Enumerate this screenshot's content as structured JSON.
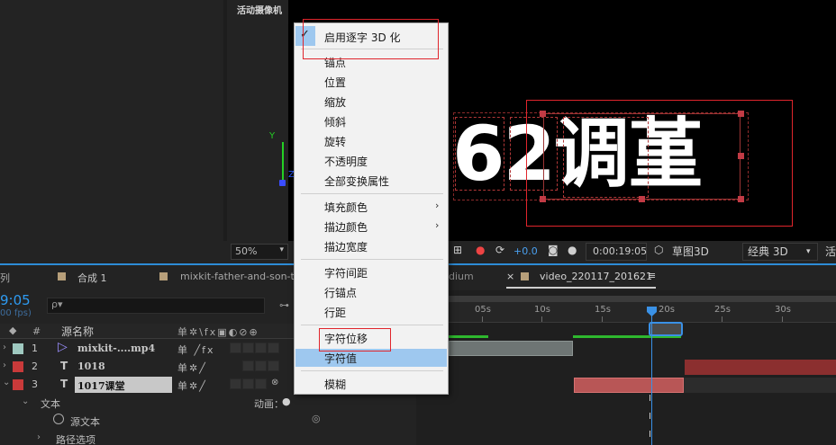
{
  "camera_panel": {
    "title": "活动摄像机",
    "zoom": "50%",
    "axis_y": "Y",
    "axis_z": "Z"
  },
  "viewer": {
    "text": "62调堇"
  },
  "viewer_toolbar": {
    "plus_value": "+0.0",
    "timecode": "0:00:19:05",
    "draft3d": "草图3D",
    "renderer": "经典 3D",
    "active": "活"
  },
  "context_menu": {
    "items": [
      {
        "label": "启用逐字 3D 化",
        "checked": true
      },
      {
        "label": "锚点"
      },
      {
        "label": "位置"
      },
      {
        "label": "缩放"
      },
      {
        "label": "倾斜"
      },
      {
        "label": "旋转"
      },
      {
        "label": "不透明度"
      },
      {
        "label": "全部变换属性"
      },
      {
        "label": "填充颜色",
        "submenu": true
      },
      {
        "label": "描边颜色",
        "submenu": true
      },
      {
        "label": "描边宽度"
      },
      {
        "label": "字符间距"
      },
      {
        "label": "行锚点"
      },
      {
        "label": "行距"
      },
      {
        "label": "字符位移"
      },
      {
        "label": "字符值",
        "highlighted": true
      },
      {
        "label": "模糊"
      }
    ]
  },
  "tabs": [
    {
      "label": "合成 1"
    },
    {
      "label": "mixkit-father-and-son-thro"
    },
    {
      "label": "dium"
    },
    {
      "label": "video_220117_201621",
      "active": true,
      "close": "×",
      "menu": "≡"
    }
  ],
  "timeline": {
    "timecode": "9:05",
    "fps": "00 fps)",
    "search_icon": "ρ▾",
    "header": {
      "num": "#",
      "name": "源名称",
      "switches": "单✲\\fx▣◐⊘⊕"
    },
    "layers": [
      {
        "num": "1",
        "name": "mixkit-....mp4",
        "color": "#9fc9c0",
        "type": "footage"
      },
      {
        "num": "2",
        "name": "1018",
        "color": "#c93a3a",
        "type": "T"
      },
      {
        "num": "3",
        "name": "1017课堂",
        "color": "#c93a3a",
        "type": "T",
        "selected": true
      }
    ],
    "text_group": "文本",
    "animate_label": "动画：",
    "source_text": "源文本",
    "path_options": "路径选项",
    "ruler": [
      "05s",
      "10s",
      "15s",
      "20s",
      "25s",
      "30s"
    ]
  },
  "colors": {
    "accent": "#2d8cd6",
    "highlight": "#9ec8ef",
    "annotation_red": "#e0252c"
  }
}
